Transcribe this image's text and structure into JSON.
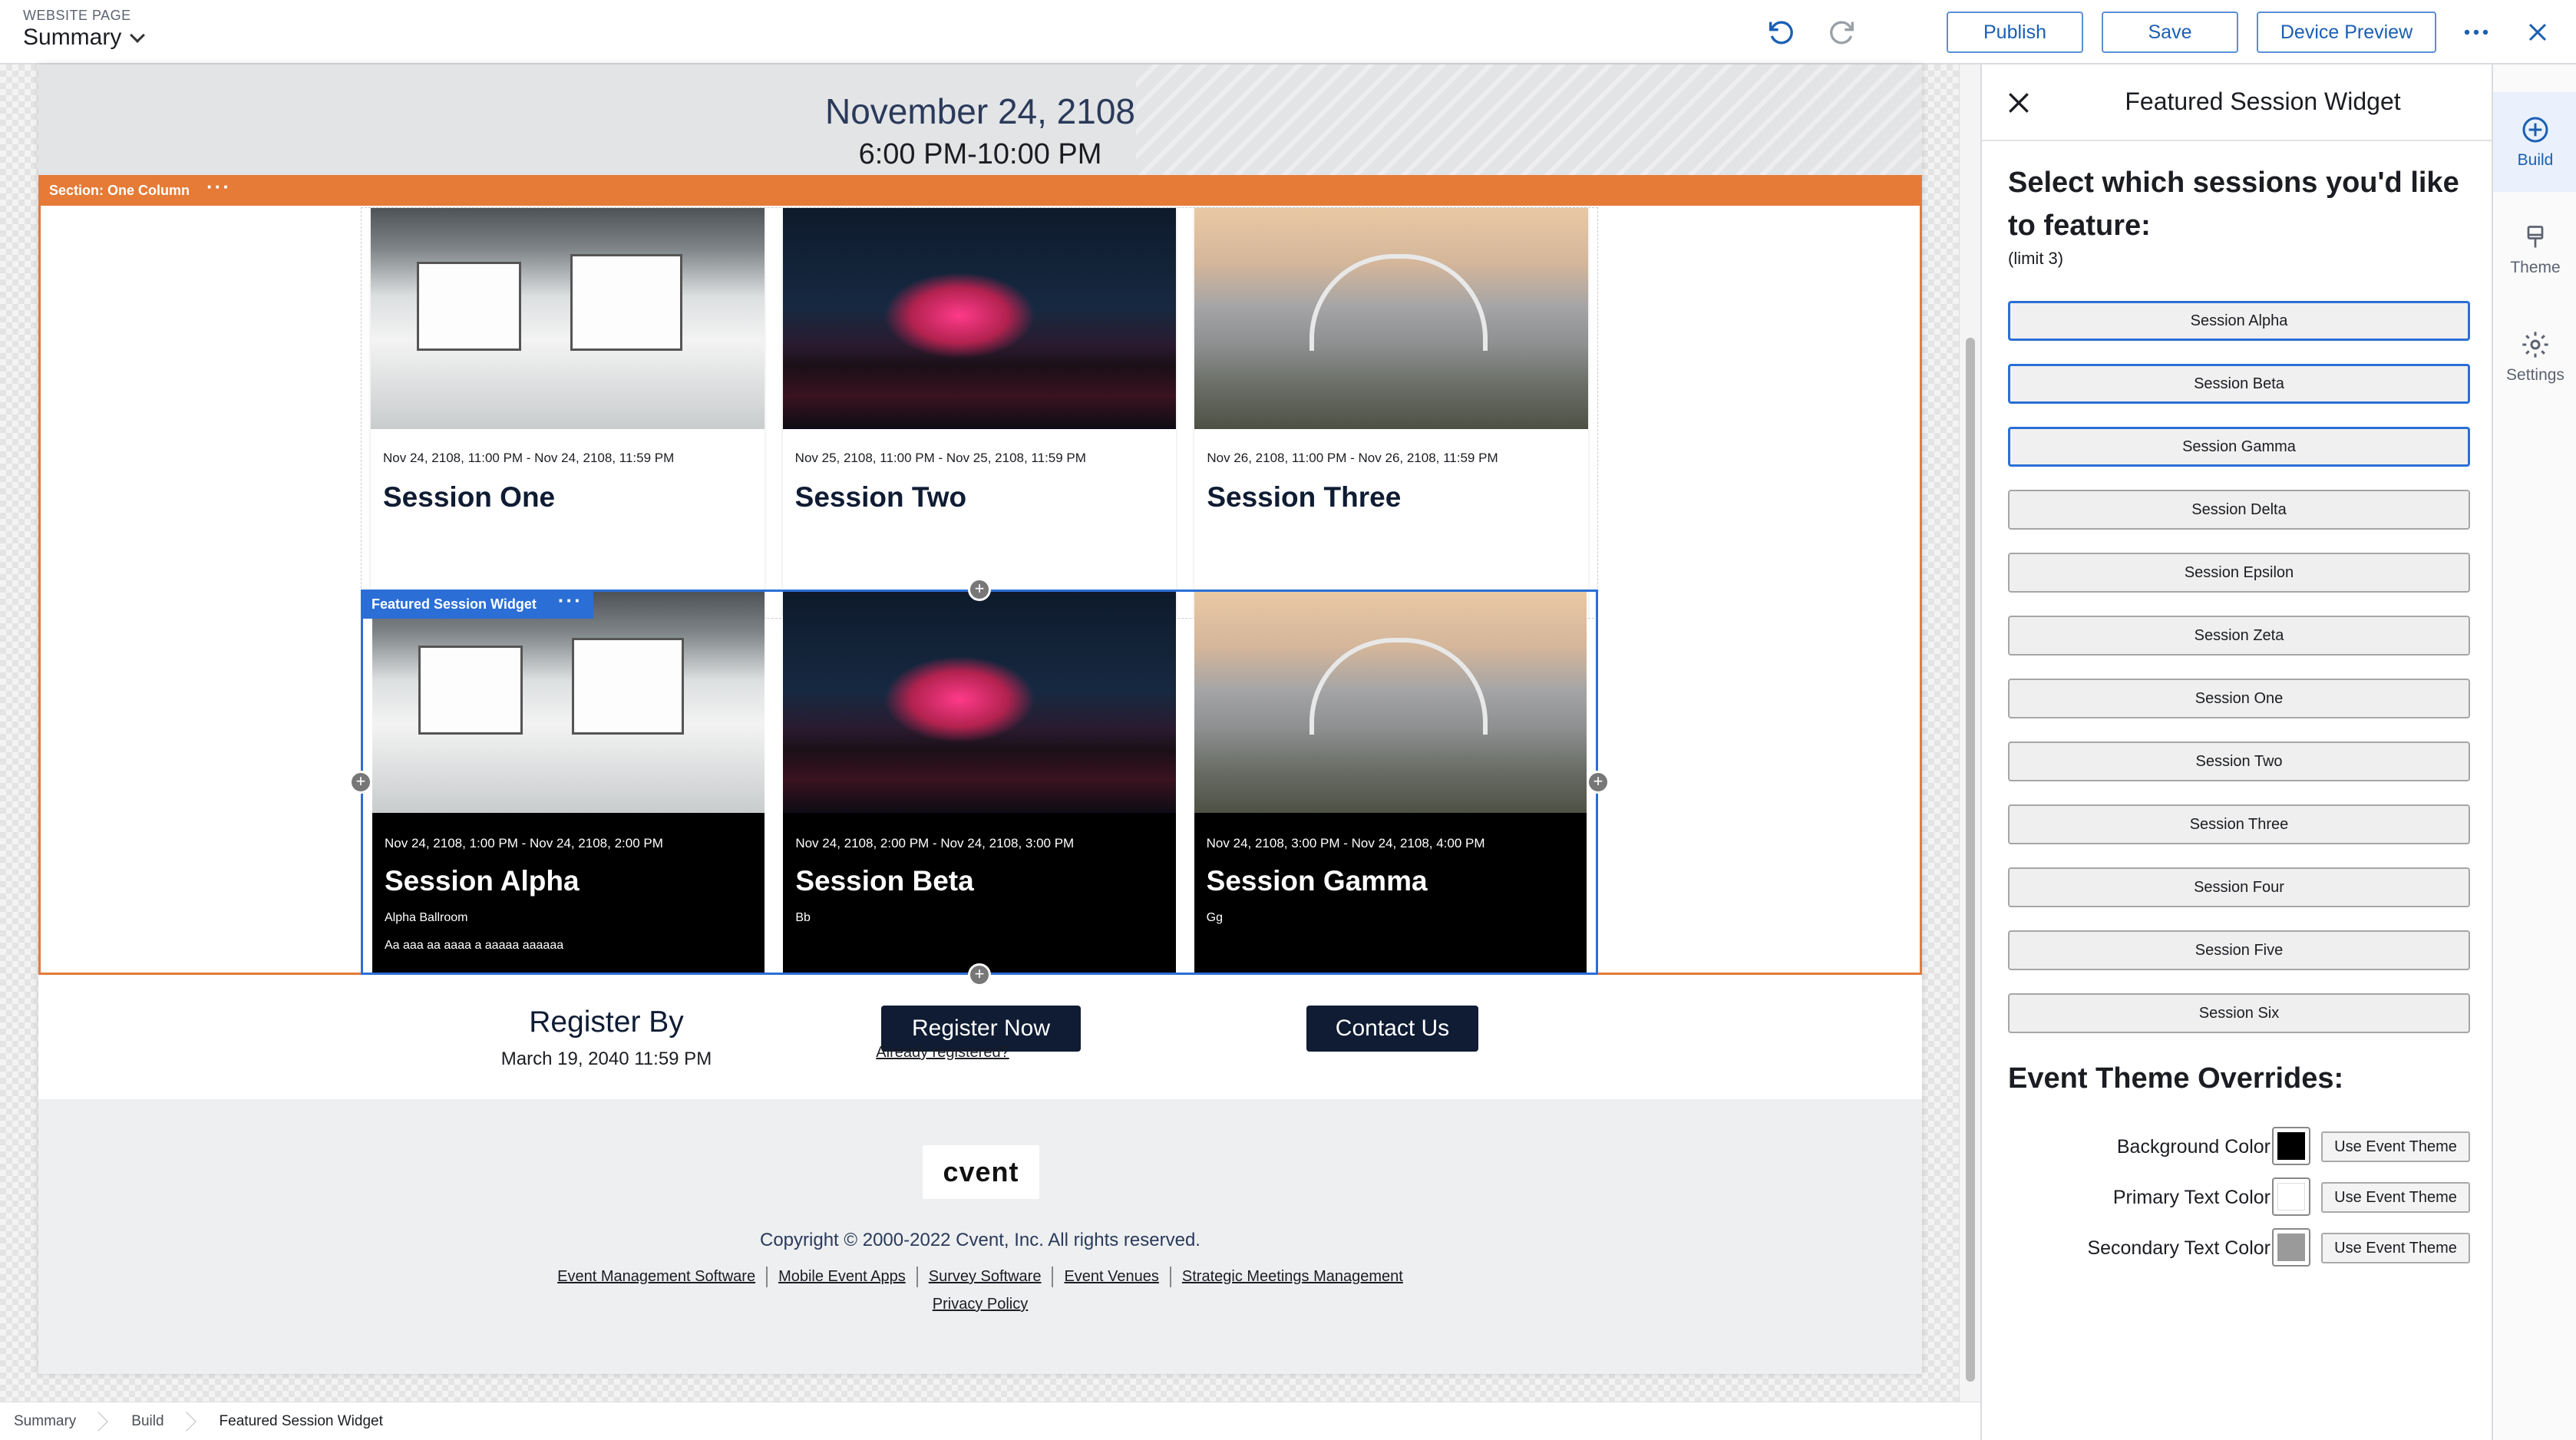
{
  "topbar": {
    "page_label": "WEBSITE PAGE",
    "page_title": "Summary",
    "buttons": {
      "publish": "Publish",
      "save": "Save",
      "device_preview": "Device Preview"
    },
    "icons": [
      "undo-icon",
      "redo-icon",
      "more-icon",
      "close-icon"
    ]
  },
  "page": {
    "hero": {
      "date": "November 24, 2108",
      "time": "6:00 PM-10:00 PM"
    },
    "section_label": "Section: One Column",
    "widget_label": "Featured Session Widget",
    "sessions_row": [
      {
        "date": "Nov 24, 2108, 11:00 PM - Nov 24, 2108, 11:59 PM",
        "title": "Session One"
      },
      {
        "date": "Nov 25, 2108, 11:00 PM - Nov 25, 2108, 11:59 PM",
        "title": "Session Two"
      },
      {
        "date": "Nov 26, 2108, 11:00 PM - Nov 26, 2108, 11:59 PM",
        "title": "Session Three"
      }
    ],
    "featured_row": [
      {
        "date": "Nov 24, 2108, 1:00 PM - Nov 24, 2108, 2:00 PM",
        "title": "Session Alpha",
        "location": "Alpha Ballroom",
        "description": "Aa aaa aa aaaa a aaaaa aaaaaa"
      },
      {
        "date": "Nov 24, 2108, 2:00 PM - Nov 24, 2108, 3:00 PM",
        "title": "Session Beta",
        "location": "Bb",
        "description": ""
      },
      {
        "date": "Nov 24, 2108, 3:00 PM - Nov 24, 2108, 4:00 PM",
        "title": "Session Gamma",
        "location": "Gg",
        "description": ""
      }
    ],
    "register": {
      "title": "Register By",
      "date": "March 19, 2040   11:59 PM",
      "register_button": "Register Now",
      "already_link": "Already registered?",
      "contact_button": "Contact Us"
    },
    "footer": {
      "logo": "cvent",
      "copyright": "Copyright © 2000-2022 Cvent, Inc. All rights reserved.",
      "links": [
        "Event Management Software",
        "Mobile Event Apps",
        "Survey Software",
        "Event Venues",
        "Strategic Meetings Management"
      ],
      "privacy": "Privacy Policy"
    }
  },
  "breadcrumb": [
    "Summary",
    "Build",
    "Featured Session Widget"
  ],
  "panel": {
    "title": "Featured Session Widget",
    "select_title": "Select which sessions you'd like to feature:",
    "limit": "(limit 3)",
    "sessions": [
      {
        "label": "Session Alpha",
        "selected": true
      },
      {
        "label": "Session Beta",
        "selected": true
      },
      {
        "label": "Session Gamma",
        "selected": true
      },
      {
        "label": "Session Delta",
        "selected": false
      },
      {
        "label": "Session Epsilon",
        "selected": false
      },
      {
        "label": "Session Zeta",
        "selected": false
      },
      {
        "label": "Session One",
        "selected": false
      },
      {
        "label": "Session Two",
        "selected": false
      },
      {
        "label": "Session Three",
        "selected": false
      },
      {
        "label": "Session Four",
        "selected": false
      },
      {
        "label": "Session Five",
        "selected": false
      },
      {
        "label": "Session Six",
        "selected": false
      }
    ],
    "overrides_title": "Event Theme Overrides:",
    "overrides": [
      {
        "label": "Background Color",
        "color": "#000000",
        "button": "Use Event Theme"
      },
      {
        "label": "Primary Text Color",
        "color": "#ffffff",
        "button": "Use Event Theme"
      },
      {
        "label": "Secondary Text Color",
        "color": "#9a9a9a",
        "button": "Use Event Theme"
      }
    ]
  },
  "rail": [
    {
      "label": "Build",
      "icon": "plus-circle-icon",
      "active": true
    },
    {
      "label": "Theme",
      "icon": "brush-icon",
      "active": false
    },
    {
      "label": "Settings",
      "icon": "gear-icon",
      "active": false
    }
  ],
  "colors": {
    "accent": "#2b6fd6",
    "section": "#e57b37",
    "navy": "#0f1c33"
  }
}
